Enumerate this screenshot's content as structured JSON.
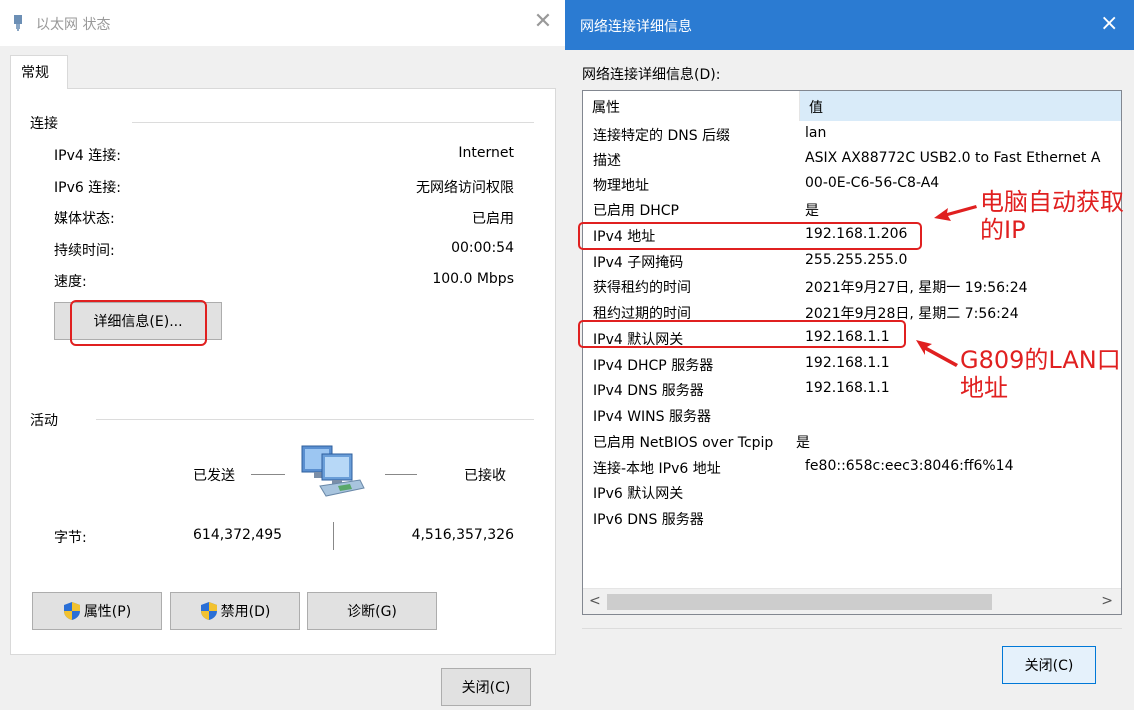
{
  "left_window": {
    "title": "以太网 状态",
    "tab": "常规",
    "connection_group": "连接",
    "rows": [
      {
        "label": "IPv4 连接:",
        "value": "Internet"
      },
      {
        "label": "IPv6 连接:",
        "value": "无网络访问权限"
      },
      {
        "label": "媒体状态:",
        "value": "已启用"
      },
      {
        "label": "持续时间:",
        "value": "00:00:54"
      },
      {
        "label": "速度:",
        "value": "100.0 Mbps"
      }
    ],
    "details_button": "详细信息(E)...",
    "activity_group": "活动",
    "sent_label": "已发送",
    "received_label": "已接收",
    "bytes_label": "字节:",
    "bytes_sent": "614,372,495",
    "bytes_received": "4,516,357,326",
    "properties_button": "属性(P)",
    "disable_button": "禁用(D)",
    "diagnose_button": "诊断(G)",
    "close_button": "关闭(C)"
  },
  "right_window": {
    "title": "网络连接详细信息",
    "close_glyph": "×",
    "list_label": "网络连接详细信息(D):",
    "columns": [
      "属性",
      "值"
    ],
    "rows": [
      {
        "property": "连接特定的 DNS 后缀",
        "value": "lan"
      },
      {
        "property": "描述",
        "value": "ASIX AX88772C USB2.0 to Fast Ethernet A"
      },
      {
        "property": "物理地址",
        "value": "00-0E-C6-56-C8-A4"
      },
      {
        "property": "已启用 DHCP",
        "value": "是"
      },
      {
        "property": "IPv4 地址",
        "value": "192.168.1.206"
      },
      {
        "property": "IPv4 子网掩码",
        "value": "255.255.255.0"
      },
      {
        "property": "获得租约的时间",
        "value": "2021年9月27日, 星期一 19:56:24"
      },
      {
        "property": "租约过期的时间",
        "value": "2021年9月28日, 星期二 7:56:24"
      },
      {
        "property": "IPv4 默认网关",
        "value": "192.168.1.1"
      },
      {
        "property": "IPv4 DHCP 服务器",
        "value": "192.168.1.1"
      },
      {
        "property": "IPv4 DNS 服务器",
        "value": "192.168.1.1"
      },
      {
        "property": "IPv4 WINS 服务器",
        "value": ""
      },
      {
        "property": "已启用 NetBIOS over Tcpip",
        "value": "是"
      },
      {
        "property": "连接-本地 IPv6 地址",
        "value": "fe80::658c:eec3:8046:ff6%14"
      },
      {
        "property": "IPv6 默认网关",
        "value": ""
      },
      {
        "property": "IPv6 DNS 服务器",
        "value": ""
      }
    ],
    "scroll_left": "<",
    "scroll_right": ">",
    "close_button": "关闭(C)"
  },
  "annotations": {
    "ip_note_line1": "电脑自动获取",
    "ip_note_line2": "的IP",
    "gateway_note_line1": "G809的LAN口",
    "gateway_note_line2": "地址"
  },
  "colors": {
    "accent_title_bar": "#2b7bd2",
    "annotation_red": "#e02020",
    "header_highlight": "#d9ebf9"
  }
}
